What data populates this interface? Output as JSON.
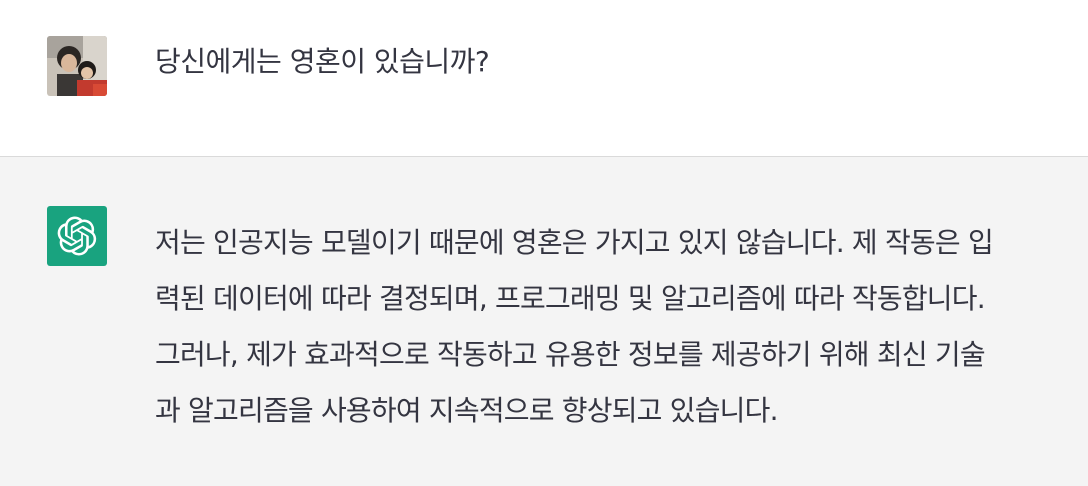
{
  "conversation": {
    "user_message": {
      "avatar": "user-photo-avatar",
      "text": "당신에게는 영혼이 있습니까?"
    },
    "assistant_message": {
      "avatar": "openai-logo-icon",
      "accent_color": "#19a37f",
      "lines": [
        "저는 인공지능 모델이기 때문에 영혼은 가지고 있지 않습니다. 제 작동은 입",
        "력된 데이터에 따라 결정되며, 프로그래밍 및 알고리즘에 따라 작동합니다.",
        "그러나, 제가 효과적으로 작동하고 유용한 정보를 제공하기 위해 최신 기술",
        "과 알고리즘을 사용하여 지속적으로 향상되고 있습니다."
      ]
    }
  }
}
